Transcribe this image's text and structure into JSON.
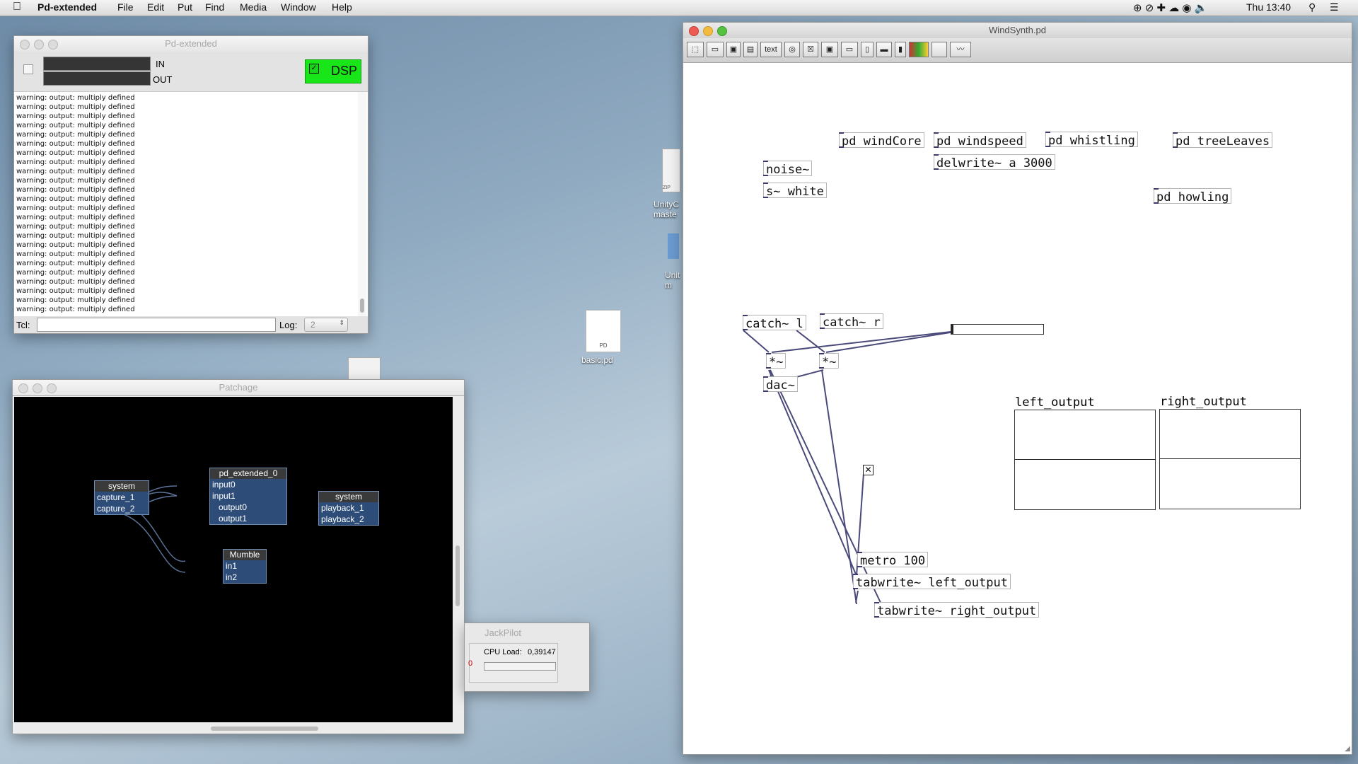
{
  "menubar": {
    "app_name": "Pd-extended",
    "menus": [
      "File",
      "Edit",
      "Put",
      "Find",
      "Media",
      "Window",
      "Help"
    ],
    "clock": "Thu 13:40"
  },
  "desktop": {
    "icons": [
      {
        "label": "basic.pd",
        "badge": "PD"
      },
      {
        "label": "UnityC\nmaste",
        "badge": "ZIP"
      },
      {
        "label": "Unit\nm",
        "badge": ""
      }
    ]
  },
  "pd_main": {
    "title": "Pd-extended",
    "in_label": "IN",
    "out_label": "OUT",
    "dsp_label": "DSP",
    "log_lines": [
      "warning: output: multiply defined",
      "warning: output: multiply defined",
      "warning: output: multiply defined",
      "warning: output: multiply defined",
      "warning: output: multiply defined",
      "warning: output: multiply defined",
      "warning: output: multiply defined",
      "warning: output: multiply defined",
      "warning: output: multiply defined",
      "warning: output: multiply defined",
      "warning: output: multiply defined",
      "warning: output: multiply defined",
      "warning: output: multiply defined",
      "warning: output: multiply defined",
      "warning: output: multiply defined",
      "warning: output: multiply defined",
      "warning: output: multiply defined",
      "warning: output: multiply defined",
      "warning: output: multiply defined",
      "warning: output: multiply defined",
      "warning: output: multiply defined",
      "warning: output: multiply defined",
      "warning: output: multiply defined",
      "warning: output: multiply defined"
    ],
    "tcl_label": "Tcl:",
    "tcl_value": "",
    "log_label": "Log:",
    "log_value": "2"
  },
  "patchage": {
    "title": "Patchage",
    "nodes": {
      "system_in": {
        "name": "system",
        "ports": [
          "capture_1",
          "capture_2"
        ]
      },
      "pd": {
        "name": "pd_extended_0",
        "inputs": [
          "input0",
          "input1"
        ],
        "outputs": [
          "output0",
          "output1"
        ]
      },
      "system_out": {
        "name": "system",
        "ports": [
          "playback_1",
          "playback_2"
        ]
      },
      "mumble": {
        "name": "Mumble",
        "ports": [
          "in1",
          "in2"
        ]
      }
    }
  },
  "jackpilot": {
    "title": "JackPilot",
    "cpu_label": "CPU Load:",
    "cpu_value": "0,39147",
    "counter": "0"
  },
  "windsynth": {
    "title": "WindSynth.pd",
    "toolbar_text_btn": "text",
    "objects": {
      "windcore": "pd windCore",
      "windspeed": "pd windspeed",
      "whistling": "pd whistling",
      "treeleaves": "pd treeLeaves",
      "delwrite": "delwrite~ a 3000",
      "noise": "noise~",
      "s_white": "s~ white",
      "howling": "pd howling",
      "catch_l": "catch~ l",
      "catch_r": "catch~ r",
      "mul_l": "*~",
      "mul_r": "*~",
      "dac": "dac~",
      "metro": "metro 100",
      "tabwrite_l": "tabwrite~ left_output",
      "tabwrite_r": "tabwrite~ right_output"
    },
    "arrays": {
      "left": "left_output",
      "right": "right_output"
    }
  }
}
